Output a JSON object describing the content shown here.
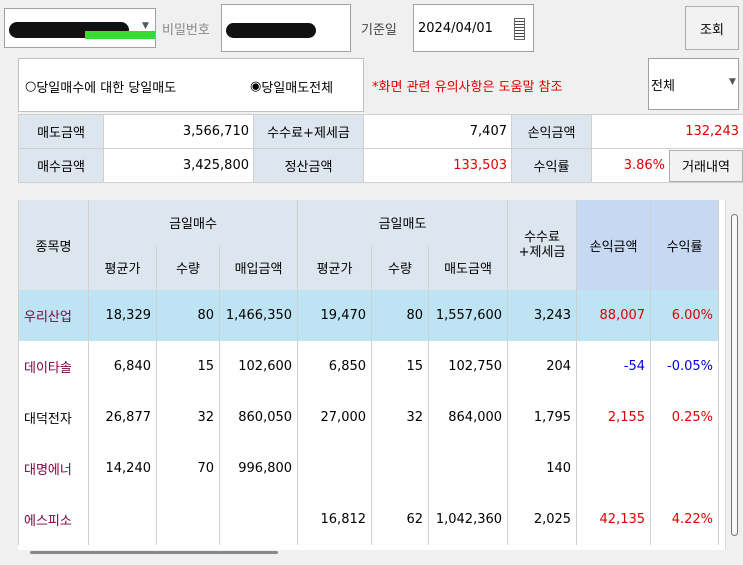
{
  "toolbar": {
    "account_arrow": "▼",
    "password_label": "비밀번호",
    "date_label": "기준일",
    "date_value": "2024/04/01",
    "query_button": "조회"
  },
  "options": {
    "radio1_label": "당일매수에 대한 당일매도",
    "radio2_label": "당일매도전체",
    "notice": "*화면 관련 유의사항은 도움말 참조",
    "filter_value": "전체",
    "filter_arrow": "▼"
  },
  "summary": {
    "sell_amount_label": "매도금액",
    "sell_amount": "3,566,710",
    "fee_tax_label": "수수료+제세금",
    "fee_tax": "7,407",
    "pnl_label": "손익금액",
    "pnl": "132,243",
    "buy_amount_label": "매수금액",
    "buy_amount": "3,425,800",
    "settlement_label": "정산금액",
    "settlement": "133,503",
    "return_label": "수익률",
    "return_rate": "3.86%",
    "history_button": "거래내역"
  },
  "grid": {
    "header": {
      "name": "종목명",
      "buy_group": "금일매수",
      "sell_group": "금일매도",
      "fee_line1": "수수료",
      "fee_line2": "+제세금",
      "pnl": "손익금액",
      "rate": "수익률",
      "buy_avg": "평균가",
      "buy_qty": "수량",
      "buy_amt": "매입금액",
      "sell_avg": "평균가",
      "sell_qty": "수량",
      "sell_amt": "매도금액"
    },
    "rows": [
      {
        "name": "우리산업",
        "buy_avg": "18,329",
        "buy_qty": "80",
        "buy_amt": "1,466,350",
        "sell_avg": "19,470",
        "sell_qty": "80",
        "sell_amt": "1,557,600",
        "fee": "3,243",
        "pnl": "88,007",
        "rate": "6.00%"
      },
      {
        "name": "데이타솔",
        "buy_avg": "6,840",
        "buy_qty": "15",
        "buy_amt": "102,600",
        "sell_avg": "6,850",
        "sell_qty": "15",
        "sell_amt": "102,750",
        "fee": "204",
        "pnl": "-54",
        "rate": "-0.05%"
      },
      {
        "name": "대덕전자",
        "buy_avg": "26,877",
        "buy_qty": "32",
        "buy_amt": "860,050",
        "sell_avg": "27,000",
        "sell_qty": "32",
        "sell_amt": "864,000",
        "fee": "1,795",
        "pnl": "2,155",
        "rate": "0.25%"
      },
      {
        "name": "대명에너",
        "buy_avg": "14,240",
        "buy_qty": "70",
        "buy_amt": "996,800",
        "sell_avg": "",
        "sell_qty": "",
        "sell_amt": "",
        "fee": "140",
        "pnl": "",
        "rate": ""
      },
      {
        "name": "에스피소",
        "buy_avg": "",
        "buy_qty": "",
        "buy_amt": "",
        "sell_avg": "16,812",
        "sell_qty": "62",
        "sell_amt": "1,042,360",
        "fee": "2,025",
        "pnl": "42,135",
        "rate": "4.22%"
      }
    ]
  },
  "colors": {
    "header_bg": "#dde6ee",
    "selected_row_bg": "#bee3f3",
    "profit": "#e00000",
    "loss": "#0000e0",
    "stock_name": "#800040"
  }
}
